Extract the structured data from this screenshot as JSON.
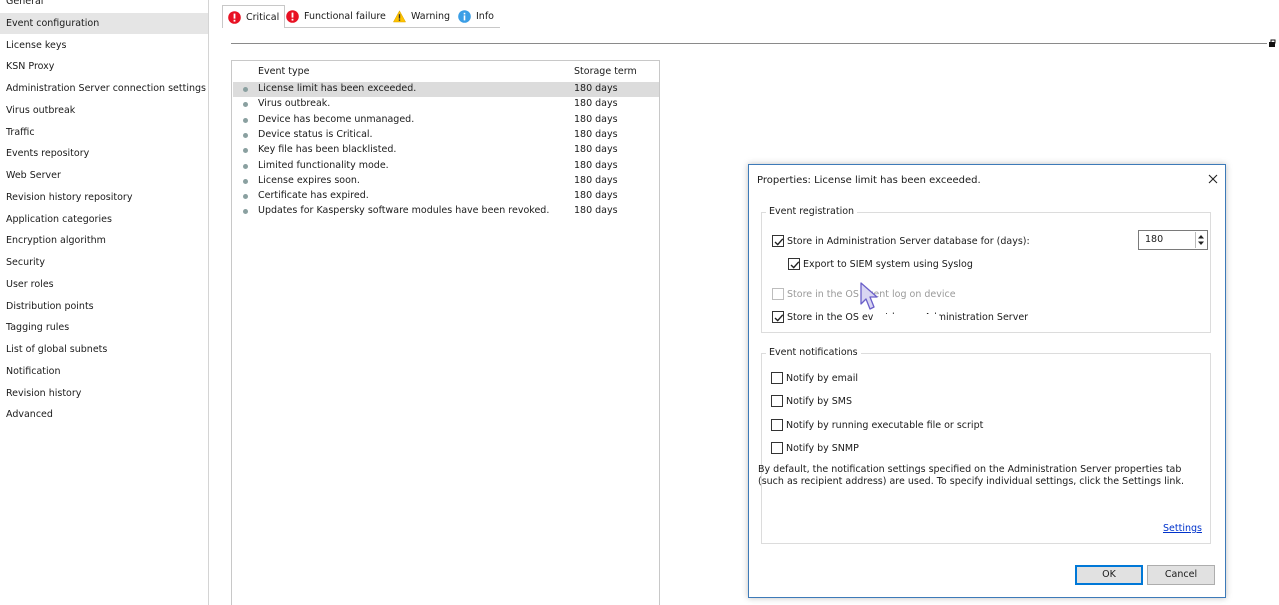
{
  "sidebar": {
    "selected_index": 1,
    "items": [
      {
        "label": "General"
      },
      {
        "label": "Event configuration"
      },
      {
        "label": "License keys"
      },
      {
        "label": "KSN Proxy"
      },
      {
        "label": "Administration Server connection settings"
      },
      {
        "label": "Virus outbreak"
      },
      {
        "label": "Traffic"
      },
      {
        "label": "Events repository"
      },
      {
        "label": "Web Server"
      },
      {
        "label": "Revision history repository"
      },
      {
        "label": "Application categories"
      },
      {
        "label": "Encryption algorithm"
      },
      {
        "label": "Security"
      },
      {
        "label": "User roles"
      },
      {
        "label": "Distribution points"
      },
      {
        "label": "Tagging rules"
      },
      {
        "label": "List of global subnets"
      },
      {
        "label": "Notification"
      },
      {
        "label": "Revision history"
      },
      {
        "label": "Advanced"
      }
    ]
  },
  "tabs": [
    {
      "label": "Critical",
      "icon": "critical-icon",
      "color": "#e81123"
    },
    {
      "label": "Functional failure",
      "icon": "functional-failure-icon",
      "color": "#e81123"
    },
    {
      "label": "Warning",
      "icon": "warning-icon",
      "color": "#ffc300"
    },
    {
      "label": "Info",
      "icon": "info-icon",
      "color": "#3a9ee6"
    }
  ],
  "active_tab": 0,
  "table": {
    "headers": {
      "type": "Event type",
      "term": "Storage term"
    },
    "selected_row": 0,
    "rows": [
      {
        "type": "License limit has been exceeded.",
        "term": "180 days"
      },
      {
        "type": "Virus outbreak.",
        "term": "180 days"
      },
      {
        "type": "Device has become unmanaged.",
        "term": "180 days"
      },
      {
        "type": "Device status is Critical.",
        "term": "180 days"
      },
      {
        "type": "Key file has been blacklisted.",
        "term": "180 days"
      },
      {
        "type": "Limited functionality mode.",
        "term": "180 days"
      },
      {
        "type": "License expires soon.",
        "term": "180 days"
      },
      {
        "type": "Certificate has expired.",
        "term": "180 days"
      },
      {
        "type": "Updates for Kaspersky software modules have been revoked.",
        "term": "180 days"
      }
    ]
  },
  "dialog": {
    "title": "Properties: License limit has been exceeded.",
    "registration": {
      "label": "Event registration",
      "store_db": {
        "label": "Store in Administration Server database for (days):",
        "checked": true,
        "days": "180"
      },
      "export_siem": {
        "label": "Export to SIEM system using Syslog",
        "checked": true
      },
      "store_os_device": {
        "label": "Store in the OS event log on device",
        "checked": false,
        "disabled": true
      },
      "store_os_server": {
        "label": "Store in the OS event log on Administration Server",
        "checked": true
      }
    },
    "notifications": {
      "label": "Event notifications",
      "email": {
        "label": "Notify by email",
        "checked": false
      },
      "sms": {
        "label": "Notify by SMS",
        "checked": false
      },
      "script": {
        "label": "Notify by running executable file or script",
        "checked": false
      },
      "snmp": {
        "label": "Notify by SNMP",
        "checked": false
      },
      "note": "By default, the notification settings specified on the Administration Server properties tab (such as recipient address) are used. To specify individual settings, click the Settings link.",
      "settings_link": "Settings"
    },
    "ok_label": "OK",
    "cancel_label": "Cancel"
  },
  "colors": {
    "dialog_border": "#3d7ab8",
    "link": "#0033cc",
    "selection": "#dcdcdc"
  }
}
